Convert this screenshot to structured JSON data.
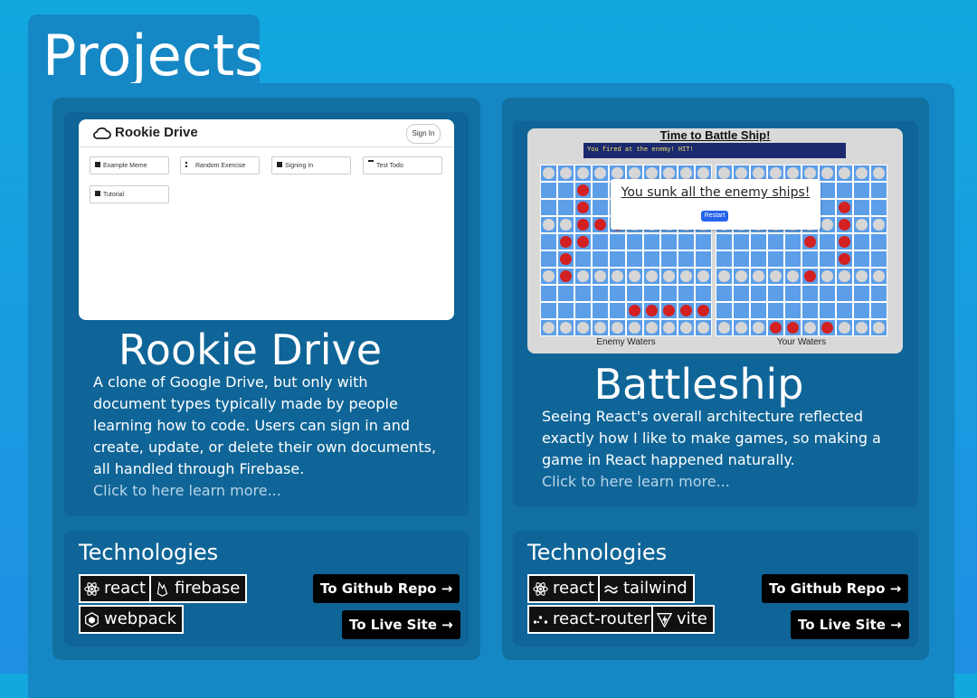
{
  "page": {
    "title": "Projects"
  },
  "projects": [
    {
      "title": "Rookie Drive",
      "description": "A clone of Google Drive, but only with document types typically made by people learning how to code. Users can sign in and create, update, or delete their own documents, all handled through Firebase.",
      "learn_more": "Click to here learn more...",
      "technologies_title": "Technologies",
      "technologies": [
        "react",
        "firebase",
        "webpack"
      ],
      "github_button": "To Github Repo →",
      "live_button": "To Live Site →",
      "screenshot": {
        "brand": "Rookie Drive",
        "sign_in": "Sign In",
        "documents": [
          "Example Meme",
          "Random Exercise",
          "Signing In",
          "Test Todo",
          "Tutorial"
        ]
      }
    },
    {
      "title": "Battleship",
      "description": "Seeing React's overall architecture reflected exactly how I like to make games, so making a game in React happened naturally.",
      "learn_more": "Click to here learn more...",
      "technologies_title": "Technologies",
      "technologies": [
        "react",
        "tailwind",
        "react-router",
        "vite"
      ],
      "github_button": "To Github Repo →",
      "live_button": "To Live Site →",
      "screenshot": {
        "heading": "Time to Battle Ship!",
        "message": "You fired at the enemy! HIT!",
        "popup": "You sunk all the enemy ships!",
        "restart": "Restart",
        "enemy_label": "Enemy Waters",
        "your_label": "Your Waters"
      }
    }
  ],
  "colors": {
    "background": "#12a8de",
    "panel": "#1587c4",
    "card": "#11709f",
    "hit": "#d32020",
    "miss": "#d6d6d6",
    "water": "#5c9ee8",
    "ship": "#66707a"
  },
  "icons": {
    "react": "react-icon",
    "firebase": "firebase-icon",
    "webpack": "webpack-icon",
    "tailwind": "tailwind-icon",
    "react-router": "react-router-icon",
    "vite": "vite-icon",
    "cloud": "cloud-icon"
  }
}
